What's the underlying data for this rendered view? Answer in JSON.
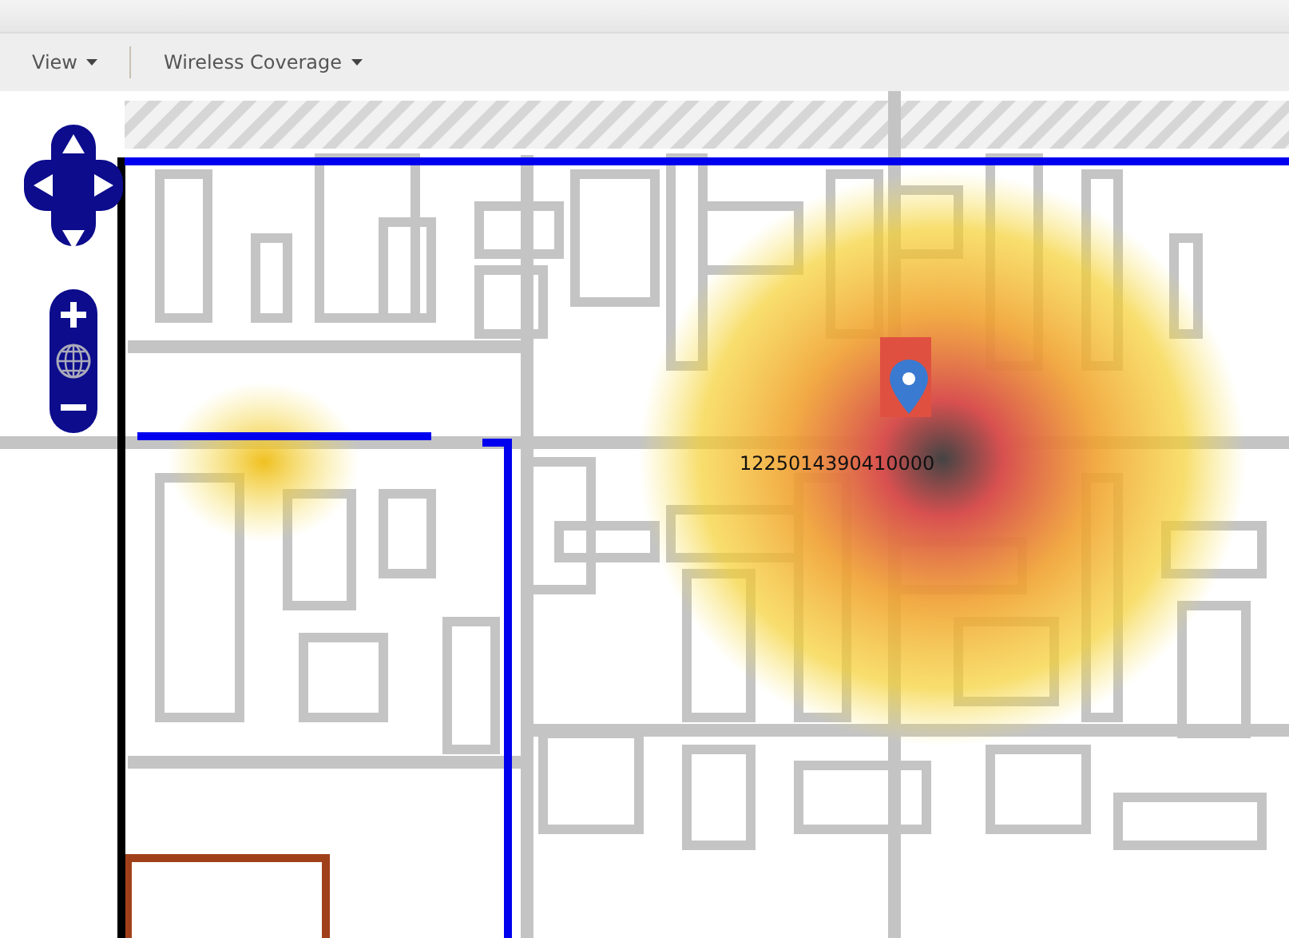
{
  "toolbar": {
    "menus": [
      {
        "label": "View"
      },
      {
        "label": "Wireless Coverage"
      }
    ]
  },
  "map": {
    "marker": {
      "label": "1225014390410000"
    }
  }
}
